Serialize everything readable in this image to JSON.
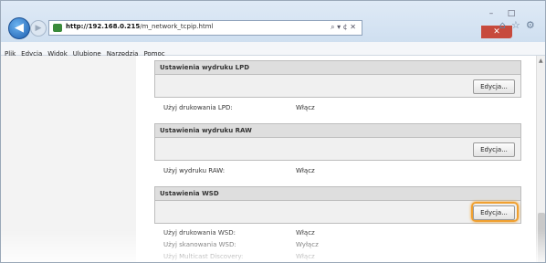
{
  "browser": {
    "url_host": "http://192.168.0.215",
    "url_path": "/m_network_tcpip.html",
    "address_tools": "⌕ ▾ ¢ ✕",
    "menu": [
      "Plik",
      "Edycja",
      "Widok",
      "Ulubione",
      "Narzędzia",
      "Pomoc"
    ],
    "back_icon": "◀",
    "forward_icon": "▶",
    "toolbar_icons": "⌂☆⚙",
    "window_controls": [
      "–",
      "□",
      "✕"
    ]
  },
  "sections": [
    {
      "title": "Ustawienia wydruku LPD",
      "edit_label": "Edycja...",
      "rows": [
        {
          "label": "Użyj drukowania LPD:",
          "value": "Włącz"
        }
      ]
    },
    {
      "title": "Ustawienia wydruku RAW",
      "edit_label": "Edycja...",
      "rows": [
        {
          "label": "Użyj wydruku RAW:",
          "value": "Włącz"
        }
      ]
    },
    {
      "title": "Ustawienia WSD",
      "edit_label": "Edycja...",
      "rows": [
        {
          "label": "Użyj drukowania WSD:",
          "value": "Włącz"
        },
        {
          "label": "Użyj skanowania WSD:",
          "value": "Wyłącz"
        },
        {
          "label": "Użyj Multicast Discovery:",
          "value": "Włącz"
        }
      ]
    }
  ],
  "colors": {
    "highlight": "#f0a030",
    "close_button": "#c74a3d"
  }
}
